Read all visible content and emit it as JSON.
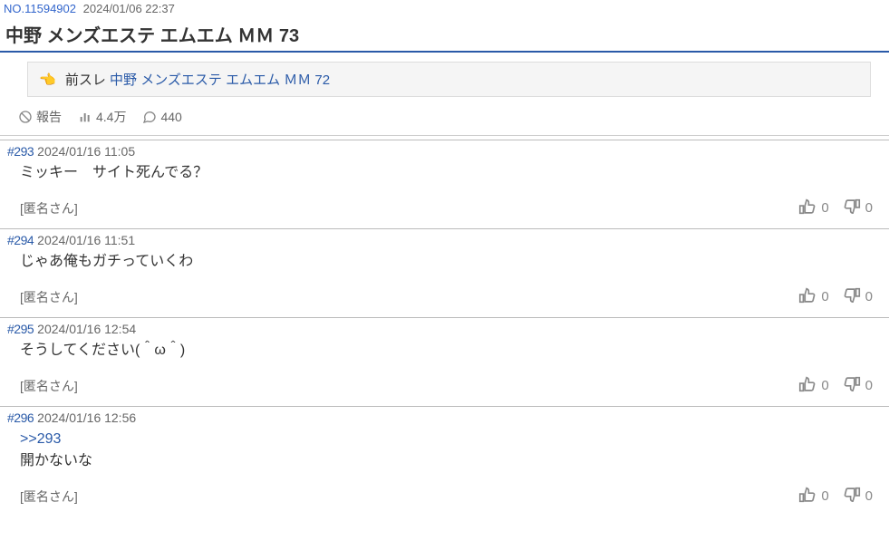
{
  "thread": {
    "number_label": "NO.11594902",
    "date": "2024/01/06 22:37",
    "title": "中野 メンズエステ エムエム ＭＭ 73",
    "prev_label": "前スレ",
    "prev_link_text": "中野 メンズエステ エムエム ＭＭ 72"
  },
  "stats": {
    "report_label": "報告",
    "views": "4.4万",
    "comments": "440"
  },
  "posts": [
    {
      "num": "#293",
      "date": "2024/01/16 11:05",
      "body_lines": [
        "ミッキー　サイト死んでる？"
      ],
      "name": "[匿名さん]",
      "up": "0",
      "down": "0"
    },
    {
      "num": "#294",
      "date": "2024/01/16 11:51",
      "body_lines": [
        "じゃあ俺もガチっていくわ"
      ],
      "name": "[匿名さん]",
      "up": "0",
      "down": "0"
    },
    {
      "num": "#295",
      "date": "2024/01/16 12:54",
      "body_lines": [
        "そうしてください(＾ω＾)"
      ],
      "name": "[匿名さん]",
      "up": "0",
      "down": "0"
    },
    {
      "num": "#296",
      "date": "2024/01/16 12:56",
      "reply_ref": ">>293",
      "body_lines": [
        "開かないな"
      ],
      "name": "[匿名さん]",
      "up": "0",
      "down": "0"
    }
  ]
}
